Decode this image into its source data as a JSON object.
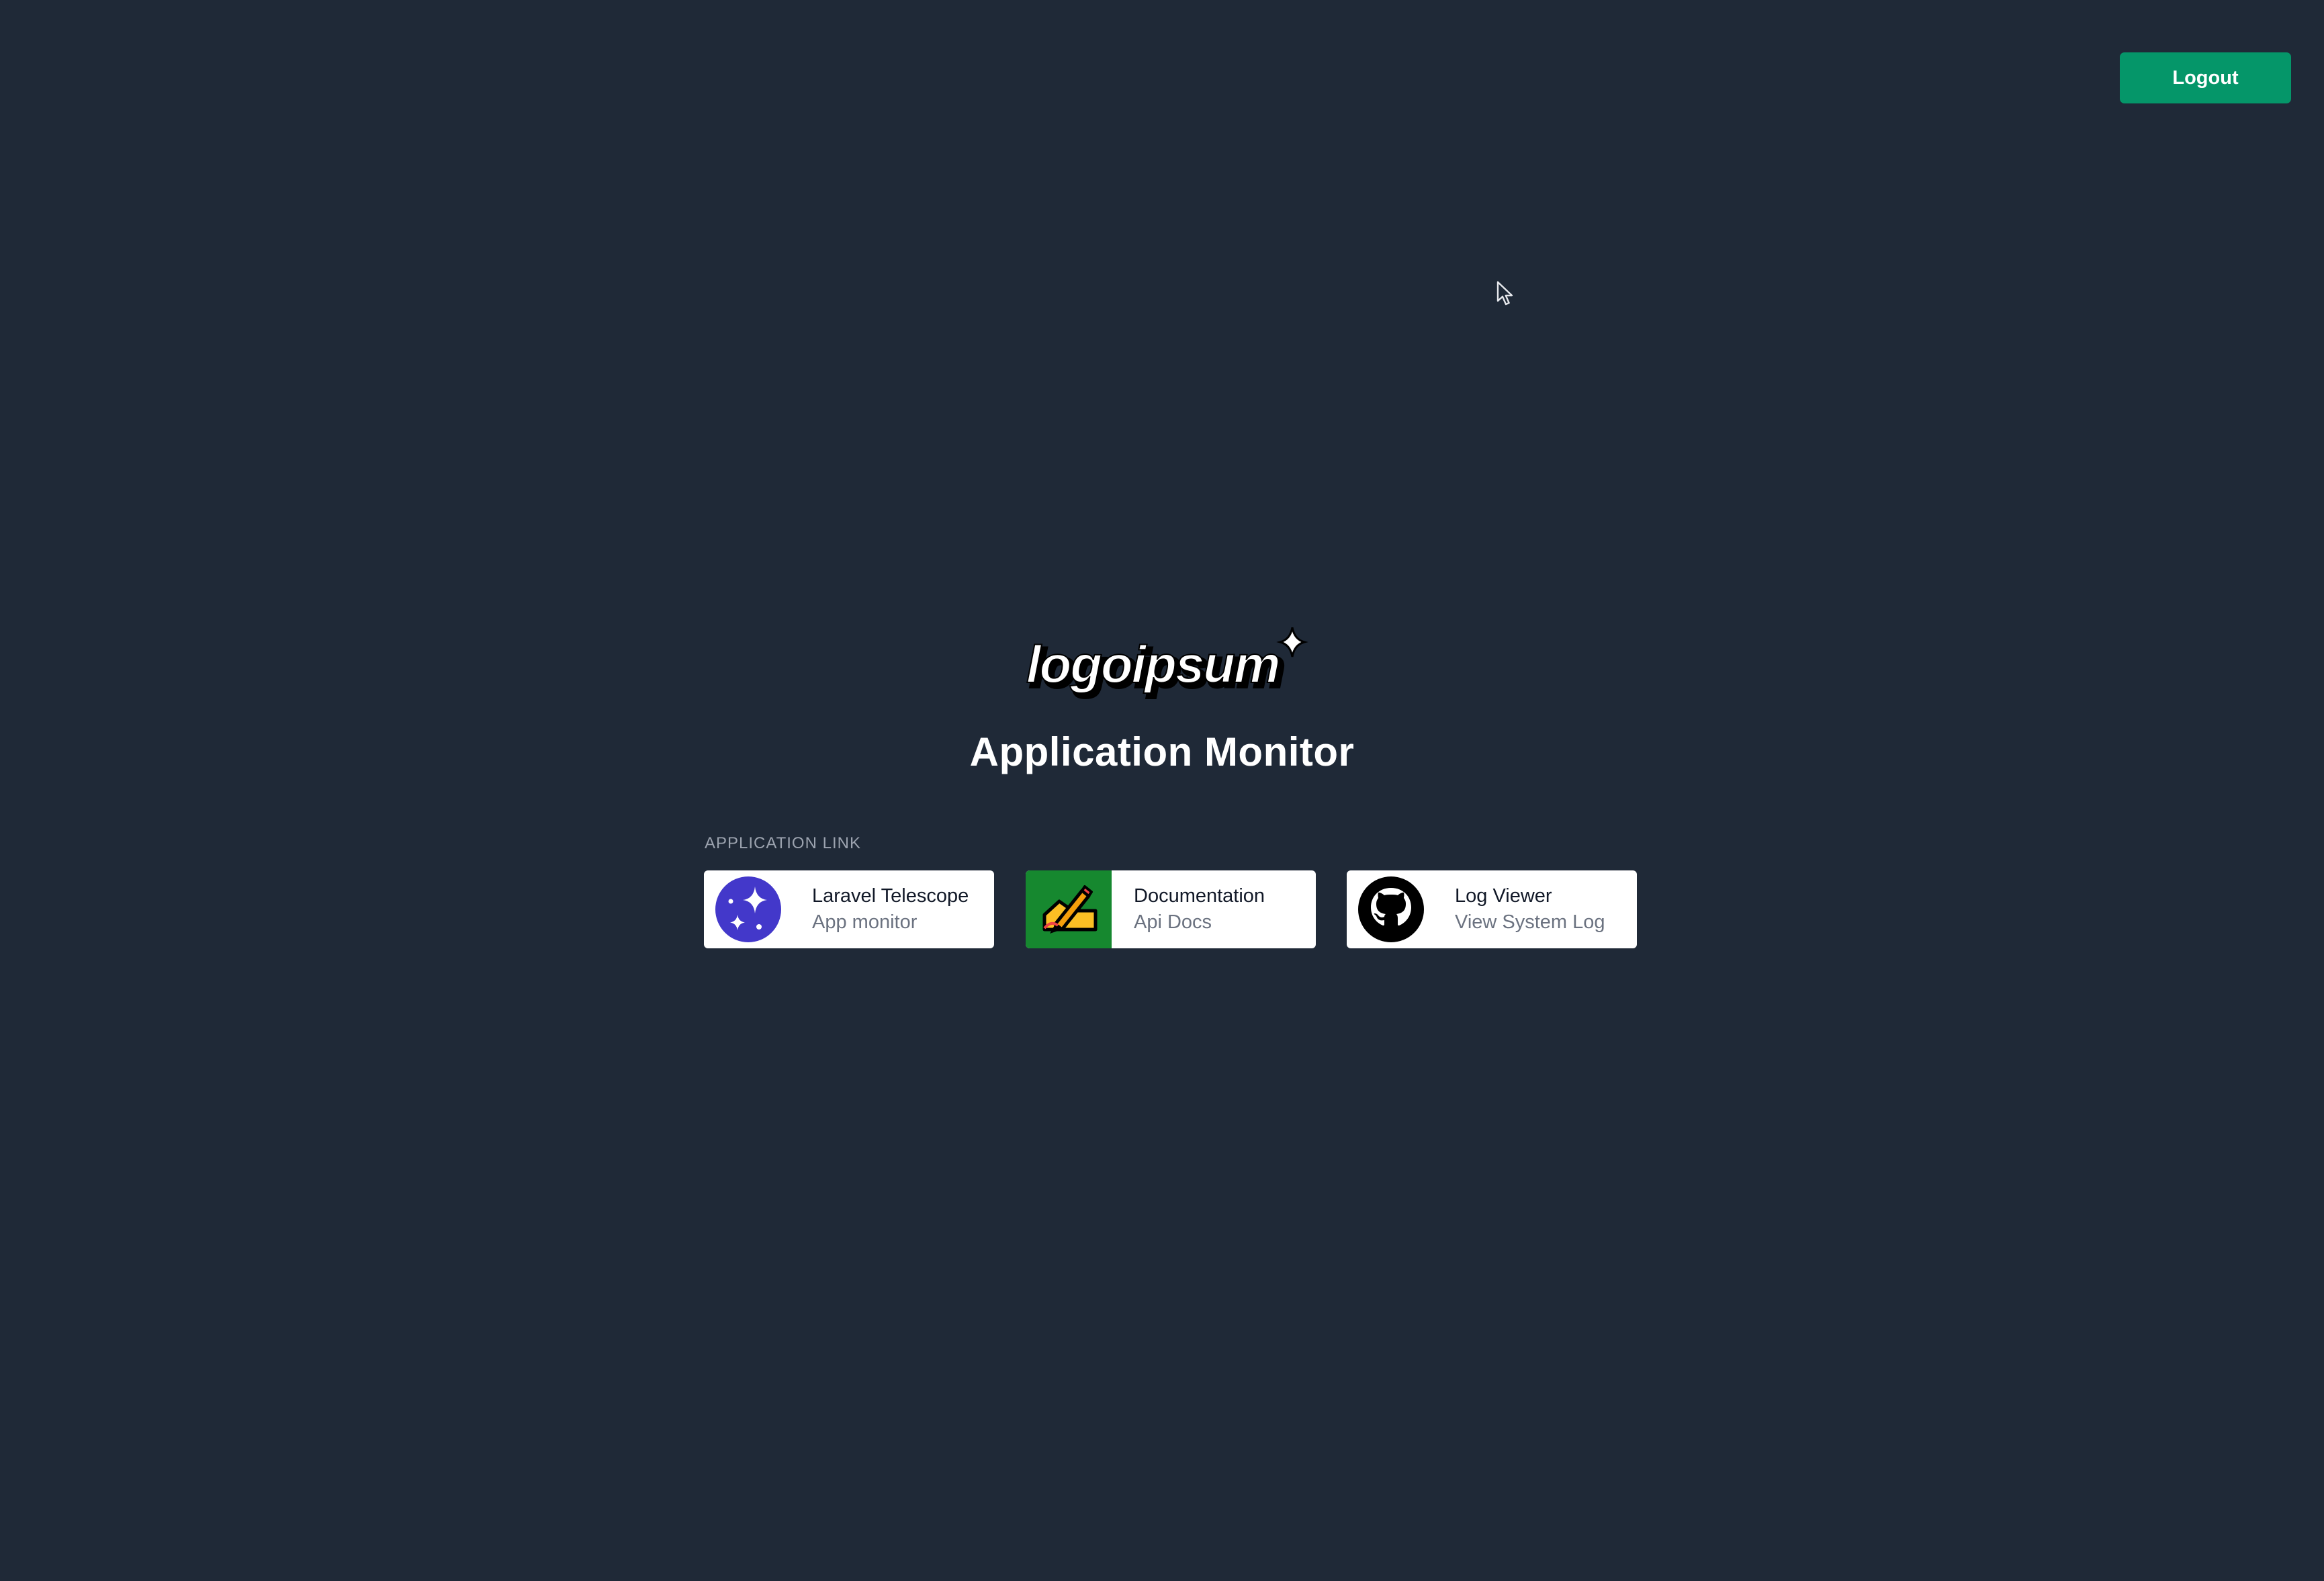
{
  "header": {
    "logout_label": "Logout"
  },
  "brand": {
    "logo_text": "logoipsum"
  },
  "page": {
    "title": "Application Monitor"
  },
  "section": {
    "label": "APPLICATION LINK"
  },
  "links": [
    {
      "title": "Laravel Telescope",
      "subtitle": "App monitor",
      "icon": "telescope-icon",
      "icon_color": "#4338ca"
    },
    {
      "title": "Documentation",
      "subtitle": "Api Docs",
      "icon": "pencil-icon",
      "icon_color": "#16882f"
    },
    {
      "title": "Log Viewer",
      "subtitle": "View System Log",
      "icon": "github-icon",
      "icon_color": "#000000"
    }
  ],
  "colors": {
    "background": "#1f2937",
    "accent": "#059669",
    "card": "#ffffff"
  }
}
